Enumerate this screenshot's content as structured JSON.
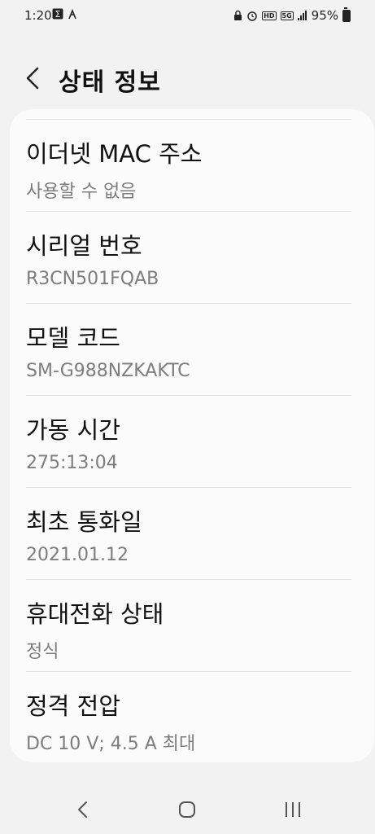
{
  "statusbar": {
    "time": "1:20",
    "left_icons": [
      "sigma-icon",
      "bug-icon"
    ],
    "network_label": "5G",
    "hd_label": "HD",
    "battery": "95%"
  },
  "header": {
    "title": "상태 정보"
  },
  "items": [
    {
      "title": "이더넷 MAC 주소",
      "value": "사용할 수 없음"
    },
    {
      "title": "시리얼 번호",
      "value": "R3CN501FQAB"
    },
    {
      "title": "모델 코드",
      "value": "SM-G988NZKAKTC"
    },
    {
      "title": "가동 시간",
      "value": "275:13:04"
    },
    {
      "title": "최초 통화일",
      "value": "2021.01.12"
    },
    {
      "title": "휴대전화 상태",
      "value": "정식"
    },
    {
      "title": "정격 전압",
      "value": "DC 10 V; 4.5 A 최대"
    }
  ],
  "navbar": {
    "icons": [
      "back-icon",
      "home-icon",
      "recents-icon"
    ]
  }
}
